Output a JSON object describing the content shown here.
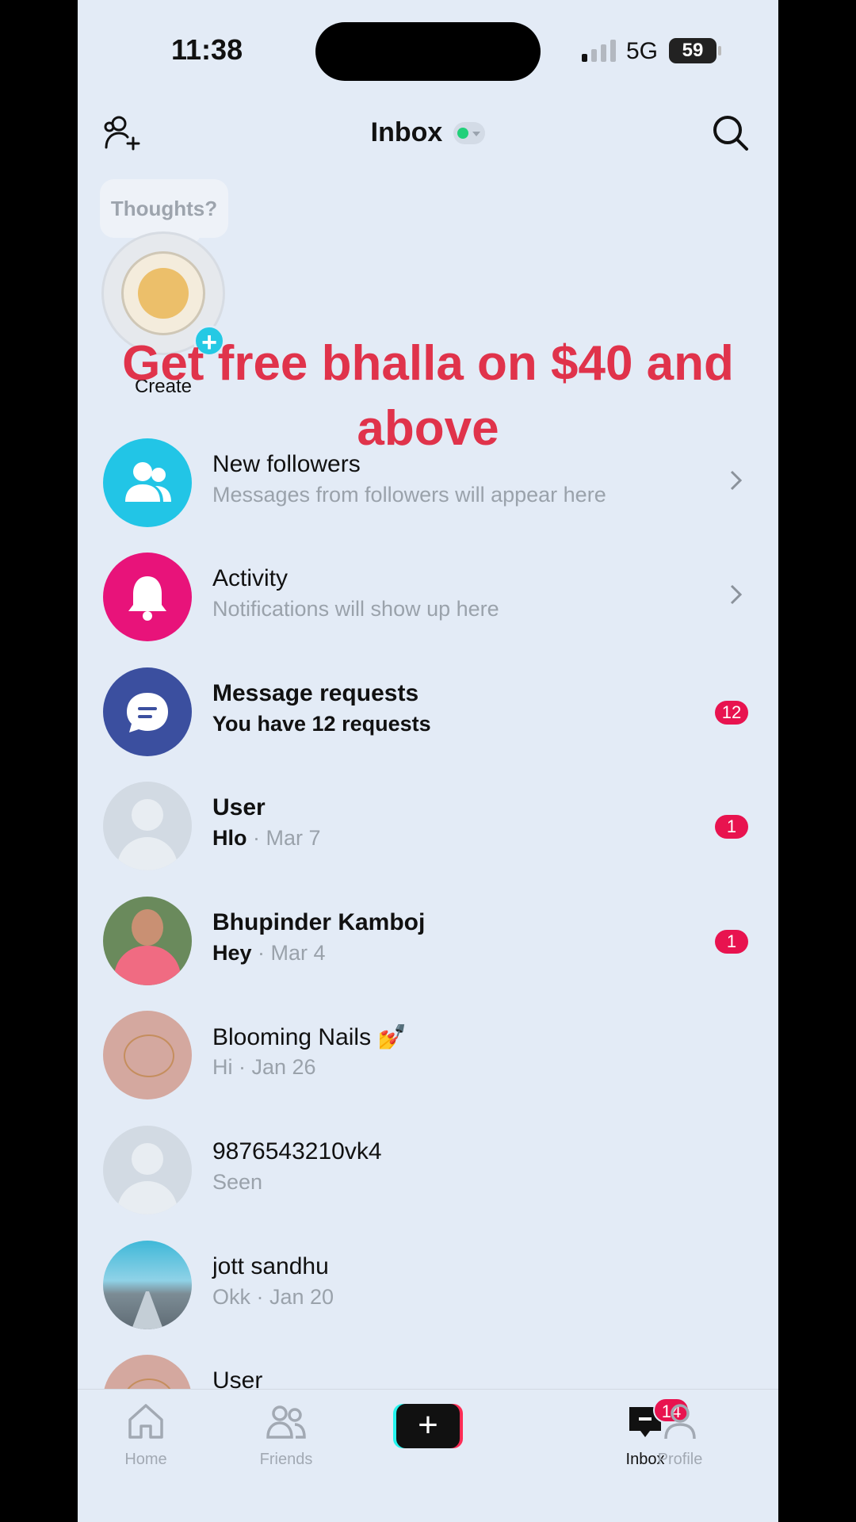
{
  "status_bar": {
    "time": "11:38",
    "network": "5G",
    "battery": "59"
  },
  "header": {
    "title": "Inbox",
    "online_color": "#21d07a"
  },
  "story": {
    "thought_placeholder": "Thoughts?",
    "label": "Create"
  },
  "promo": {
    "text": "Get free bhalla on $40 and above"
  },
  "list": {
    "new_followers": {
      "title": "New followers",
      "subtitle": "Messages from followers will appear here",
      "icon": "people-icon"
    },
    "activity": {
      "title": "Activity",
      "subtitle": "Notifications will show up here",
      "icon": "bell-icon"
    },
    "message_requests": {
      "title": "Message requests",
      "subtitle": "You have 12 requests",
      "badge": "12",
      "icon": "chat-icon"
    },
    "conversations": [
      {
        "name": "User",
        "preview": "Hlo",
        "meta": " · Mar 7",
        "badge": "1"
      },
      {
        "name": "Bhupinder Kamboj",
        "preview": "Hey",
        "meta": " · Mar 4",
        "badge": "1"
      },
      {
        "name": "Blooming Nails 💅",
        "preview": "",
        "meta": "Hi · Jan 26",
        "badge": ""
      },
      {
        "name": "9876543210vk4",
        "preview": "",
        "meta": "Seen",
        "badge": ""
      },
      {
        "name": "jott sandhu",
        "preview": "",
        "meta": "Okk · Jan 20",
        "badge": ""
      },
      {
        "name": "User",
        "preview": "",
        "meta": "",
        "badge": ""
      }
    ]
  },
  "nav": {
    "home": "Home",
    "friends": "Friends",
    "inbox": "Inbox",
    "inbox_badge": "14",
    "profile": "Profile"
  },
  "colors": {
    "accent_red": "#e8134f",
    "promo_red": "#e0334b",
    "background": "#e3ebf6"
  }
}
